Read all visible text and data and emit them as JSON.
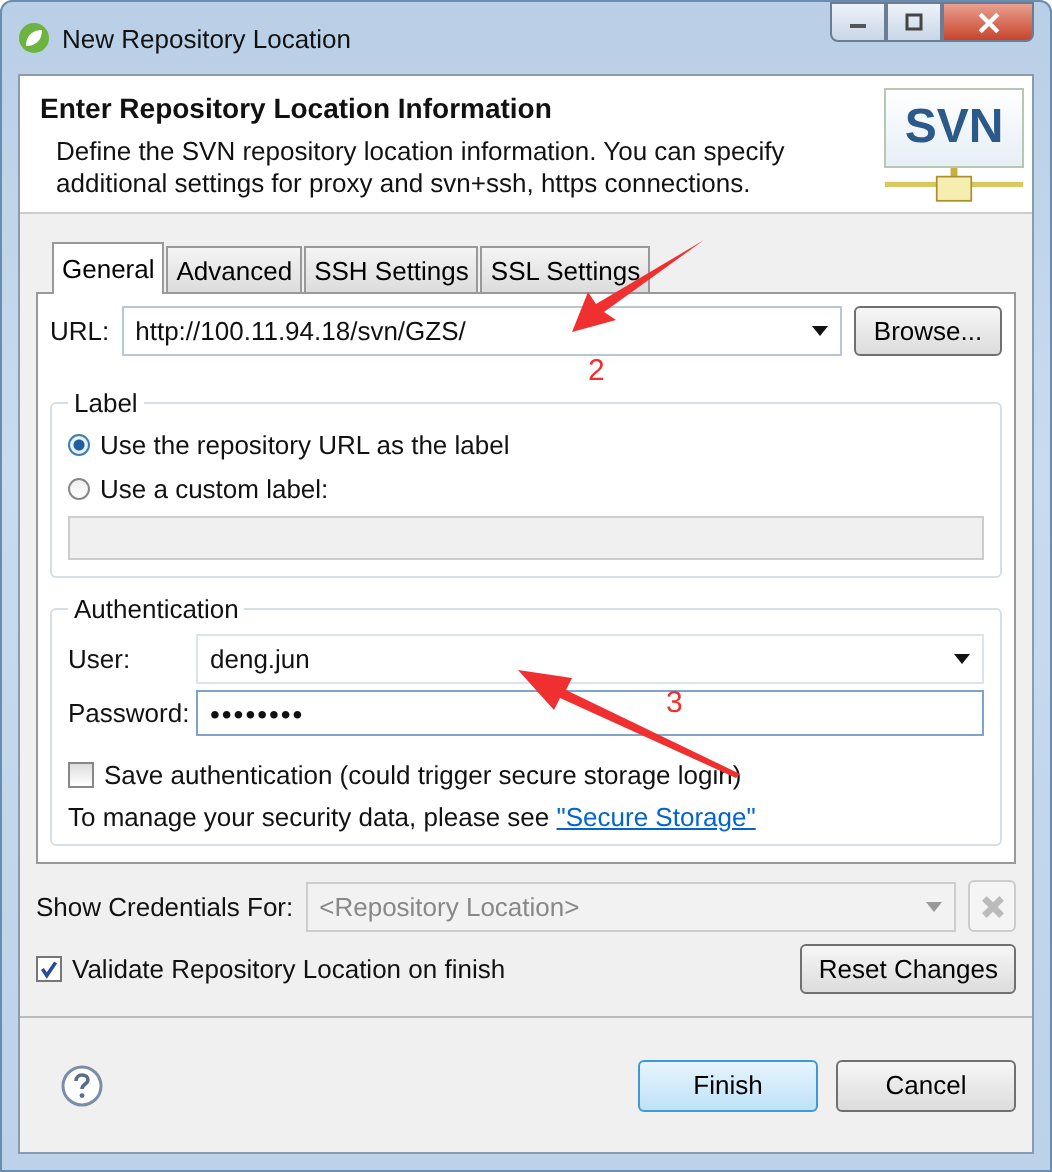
{
  "window": {
    "title": "New Repository Location"
  },
  "header": {
    "title": "Enter Repository Location Information",
    "description": "Define the SVN repository location information. You can specify additional settings for proxy and svn+ssh, https connections.",
    "logo_text": "SVN"
  },
  "tabs": [
    {
      "label": "General",
      "selected": true
    },
    {
      "label": "Advanced",
      "selected": false
    },
    {
      "label": "SSH Settings",
      "selected": false
    },
    {
      "label": "SSL Settings",
      "selected": false
    }
  ],
  "url": {
    "label": "URL:",
    "value": "http://100.11.94.18/svn/GZS/"
  },
  "browse_button": "Browse...",
  "label_group": {
    "title": "Label",
    "options": [
      {
        "label": "Use the repository URL as the label",
        "selected": true
      },
      {
        "label": "Use a custom label:",
        "selected": false
      }
    ],
    "custom_label_disabled": true
  },
  "authentication": {
    "title": "Authentication",
    "user": {
      "label": "User:",
      "value": "deng.jun"
    },
    "password": {
      "label": "Password:",
      "value": "••••••••"
    },
    "save_checkbox": {
      "label": "Save authentication (could trigger secure storage login)",
      "checked": false
    },
    "note": "To manage your security data, please see",
    "link": "\"Secure Storage\""
  },
  "show_credentials": {
    "label": "Show Credentials For:",
    "value": "<Repository Location>",
    "disabled": true
  },
  "validate_checkbox": {
    "label": "Validate Repository Location on finish",
    "checked": true
  },
  "reset_button": "Reset Changes",
  "buttons": [
    {
      "label": "Finish",
      "default": true
    },
    {
      "label": "Cancel",
      "default": false
    }
  ],
  "annotations": [
    {
      "text": "2"
    },
    {
      "text": "3"
    }
  ]
}
